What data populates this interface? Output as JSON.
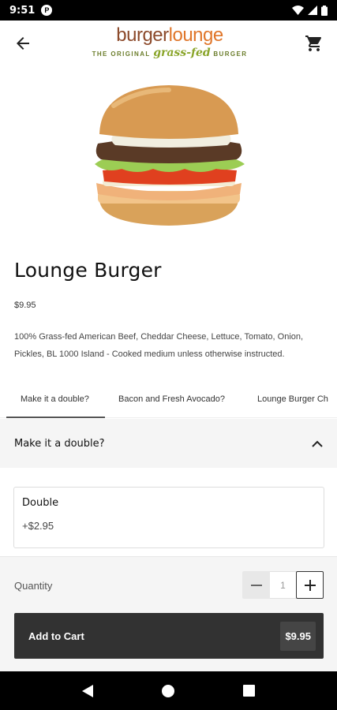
{
  "status": {
    "time": "9:51",
    "app_badge": "P"
  },
  "logo": {
    "part1": "burger",
    "part2": "lounge",
    "tag_pre": "THE ORIGINAL",
    "tag_mid": "grass-fed",
    "tag_post": "BURGER"
  },
  "product": {
    "title": "Lounge Burger",
    "price": "$9.95",
    "description": "100% Grass-fed American Beef, Cheddar Cheese, Lettuce, Tomato, Onion, Pickles, BL 1000 Island - Cooked medium unless otherwise instructed."
  },
  "tabs": [
    {
      "label": "Make it a double?"
    },
    {
      "label": "Bacon and Fresh Avocado?"
    },
    {
      "label": "Lounge Burger Ch"
    }
  ],
  "section": {
    "label": "Make it a double?"
  },
  "option": {
    "name": "Double",
    "price": "+$2.95"
  },
  "quantity": {
    "label": "Quantity",
    "value": "1"
  },
  "add_to_cart": {
    "label": "Add to Cart",
    "price": "$9.95"
  },
  "icons": {
    "back": "back-arrow-icon",
    "cart": "cart-icon",
    "chevron": "chevron-up-icon",
    "minus": "minus-icon",
    "plus": "plus-icon"
  },
  "colors": {
    "brand_brown": "#8c4a2b",
    "brand_orange": "#e0762a",
    "brand_green": "#8aa52a",
    "button_dark": "#323232"
  }
}
